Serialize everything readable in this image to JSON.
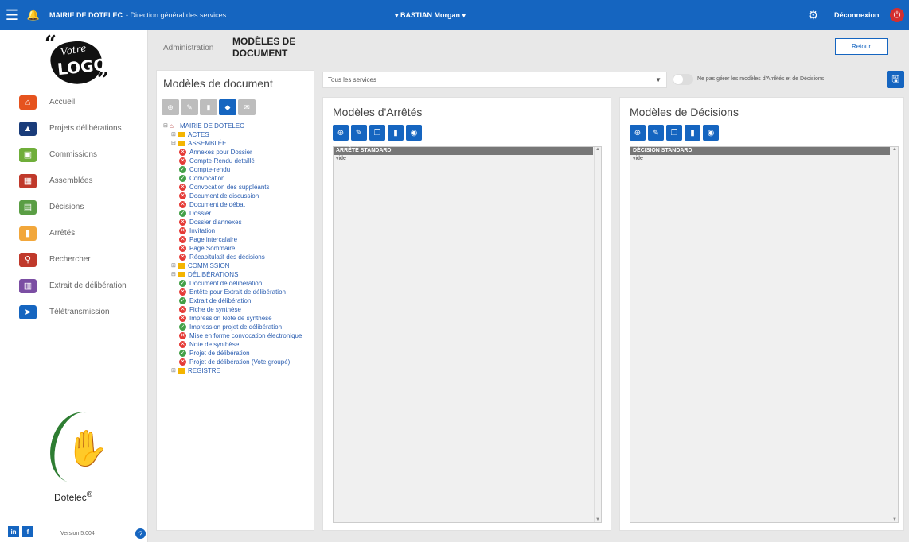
{
  "header": {
    "menu_icon": "hamburger-icon",
    "organization": "MAIRIE DE DOTELEC",
    "department": "- Direction général des services",
    "user": "▾ BASTIAN Morgan ▾",
    "logout_label": "Déconnexion"
  },
  "sidebar": {
    "logo": {
      "line1": "Votre",
      "line2": "LOGO"
    },
    "items": [
      {
        "label": "Accueil",
        "icon": "home-icon",
        "color": "#e6531e"
      },
      {
        "label": "Projets délibérations",
        "icon": "chart-icon",
        "color": "#1a3c7a"
      },
      {
        "label": "Commissions",
        "icon": "commission-icon",
        "color": "#6fae3a"
      },
      {
        "label": "Assemblées",
        "icon": "calendar-icon",
        "color": "#c0392b"
      },
      {
        "label": "Décisions",
        "icon": "document-edit-icon",
        "color": "#5a9e44"
      },
      {
        "label": "Arrêtés",
        "icon": "stamp-icon",
        "color": "#f2a73b"
      },
      {
        "label": "Rechercher",
        "icon": "search-icon",
        "color": "#c0392b"
      },
      {
        "label": "Extrait de délibération",
        "icon": "books-icon",
        "color": "#7b4ea3"
      },
      {
        "label": "Télétransmission",
        "icon": "send-icon",
        "color": "#1565c0"
      }
    ],
    "brand": "Dotelec",
    "brand_mark": "®",
    "version": "Version 5.004",
    "social": [
      "in",
      "f"
    ]
  },
  "page": {
    "breadcrumb": "Administration",
    "title": "MODÈLES DE DOCUMENT",
    "back_label": "Retour"
  },
  "left_panel": {
    "title": "Modèles de document",
    "tree": [
      {
        "level": 0,
        "kind": "home",
        "expander": "⊟",
        "label": "MAIRIE DE DOTELEC"
      },
      {
        "level": 1,
        "kind": "folder",
        "expander": "⊞",
        "label": "ACTES"
      },
      {
        "level": 1,
        "kind": "folder",
        "expander": "⊟",
        "label": "ASSEMBLÉE"
      },
      {
        "level": 2,
        "kind": "ko",
        "label": "Annexes pour Dossier"
      },
      {
        "level": 2,
        "kind": "ko",
        "label": "Compte-Rendu detaillé"
      },
      {
        "level": 2,
        "kind": "ok",
        "label": "Compte-rendu"
      },
      {
        "level": 2,
        "kind": "ok",
        "label": "Convocation"
      },
      {
        "level": 2,
        "kind": "ko",
        "label": "Convocation des suppléants"
      },
      {
        "level": 2,
        "kind": "ko",
        "label": "Document de discussion"
      },
      {
        "level": 2,
        "kind": "ko",
        "label": "Document de débat"
      },
      {
        "level": 2,
        "kind": "ok",
        "label": "Dossier"
      },
      {
        "level": 2,
        "kind": "ko",
        "label": "Dossier d'annexes"
      },
      {
        "level": 2,
        "kind": "ko",
        "label": "Invitation"
      },
      {
        "level": 2,
        "kind": "ko",
        "label": "Page intercalaire"
      },
      {
        "level": 2,
        "kind": "ko",
        "label": "Page Sommaire"
      },
      {
        "level": 2,
        "kind": "ko",
        "label": "Récapitulatif des décisions"
      },
      {
        "level": 1,
        "kind": "folder",
        "expander": "⊞",
        "label": "COMMISSION"
      },
      {
        "level": 1,
        "kind": "folder",
        "expander": "⊟",
        "label": "DÉLIBÉRATIONS"
      },
      {
        "level": 2,
        "kind": "ok",
        "label": "Document de délibération"
      },
      {
        "level": 2,
        "kind": "ko",
        "label": "Entête pour Extrait de délibération"
      },
      {
        "level": 2,
        "kind": "ok",
        "label": "Extrait de délibération"
      },
      {
        "level": 2,
        "kind": "ko",
        "label": "Fiche de synthèse"
      },
      {
        "level": 2,
        "kind": "ko",
        "label": "Impression Note de synthèse"
      },
      {
        "level": 2,
        "kind": "ok",
        "label": "Impression projet de délibération"
      },
      {
        "level": 2,
        "kind": "ko",
        "label": "Mise en forme convocation électronique"
      },
      {
        "level": 2,
        "kind": "ko",
        "label": "Note de synthèse"
      },
      {
        "level": 2,
        "kind": "ok",
        "label": "Projet de délibération"
      },
      {
        "level": 2,
        "kind": "ko",
        "label": "Projet de délibération (Vote groupé)"
      },
      {
        "level": 1,
        "kind": "folder",
        "expander": "⊞",
        "label": "REGISTRE"
      }
    ]
  },
  "filters": {
    "service_value": "Tous les services",
    "toggle_label": "Ne pas gérer les modèles d'Arrêtés et de Décisions"
  },
  "arretes_panel": {
    "title": "Modèles d'Arrêtés",
    "selected": "ARRÊTÉ STANDARD",
    "other": "vide"
  },
  "decisions_panel": {
    "title": "Modèles de Décisions",
    "selected": "DÉCISION STANDARD",
    "other": "vide"
  }
}
